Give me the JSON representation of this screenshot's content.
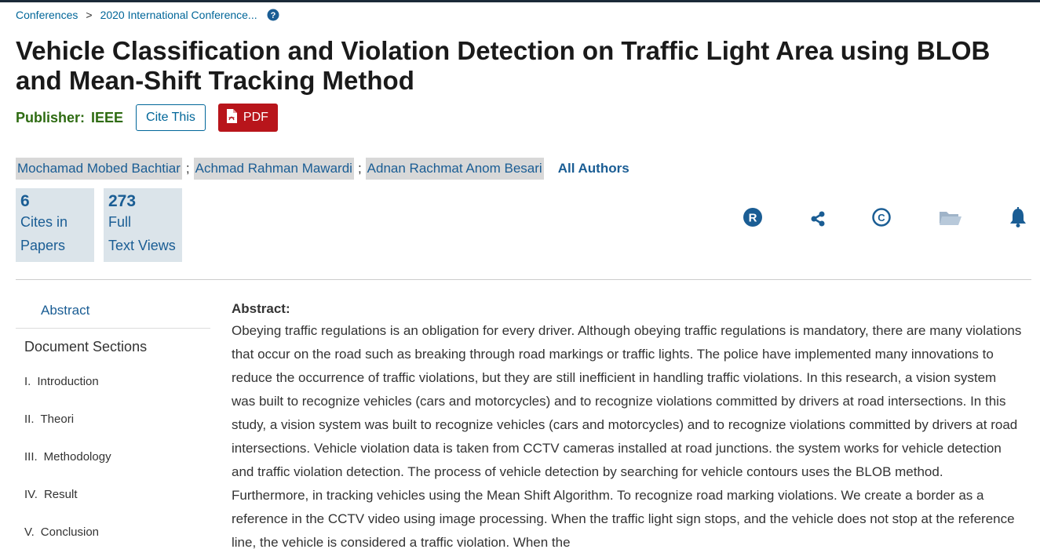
{
  "breadcrumb": {
    "items": [
      "Conferences",
      "2020 International Conference..."
    ],
    "separator": ">",
    "help_icon": "question-circle-icon"
  },
  "title": "Vehicle Classification and Violation Detection on Traffic Light Area using BLOB and Mean-Shift Tracking Method",
  "publisher": {
    "label": "Publisher:",
    "value": "IEEE"
  },
  "buttons": {
    "cite": "Cite This",
    "pdf": "PDF",
    "pdf_icon": "pdf-file-icon"
  },
  "authors": [
    "Mochamad Mobed Bachtiar",
    "Achmad Rahman Mawardi",
    "Adnan Rachmat Anom Besari"
  ],
  "author_separator": ";",
  "all_authors": "All Authors",
  "metrics": [
    {
      "value": "6",
      "line1": "Cites in",
      "line2": "Papers"
    },
    {
      "value": "273",
      "line1": "Full",
      "line2": "Text Views"
    }
  ],
  "actions": [
    "rights-icon",
    "share-icon",
    "copyright-icon",
    "folder-icon",
    "bell-icon"
  ],
  "sidebar": {
    "abstract_link": "Abstract",
    "sections_title": "Document Sections",
    "sections": [
      {
        "num": "I.",
        "label": "Introduction"
      },
      {
        "num": "II.",
        "label": "Theori"
      },
      {
        "num": "III.",
        "label": "Methodology"
      },
      {
        "num": "IV.",
        "label": "Result"
      },
      {
        "num": "V.",
        "label": "Conclusion"
      }
    ]
  },
  "abstract": {
    "heading": "Abstract:",
    "text": "Obeying traffic regulations is an obligation for every driver. Although obeying traffic regulations is mandatory, there are many violations that occur on the road such as breaking through road markings or traffic lights. The police have implemented many innovations to reduce the occurrence of traffic violations, but they are still inefficient in handling traffic violations. In this research, a vision system was built to recognize vehicles (cars and motorcycles) and to recognize violations committed by drivers at road intersections. In this study, a vision system was built to recognize vehicles (cars and motorcycles) and to recognize violations committed by drivers at road intersections. Vehicle violation data is taken from CCTV cameras installed at road junctions. the system works for vehicle detection and traffic violation detection. The process of vehicle detection by searching for vehicle contours uses the BLOB method. Furthermore, in tracking vehicles using the Mean Shift Algorithm. To recognize road marking violations. We create a border as a reference in the CCTV video using image processing. When the traffic light sign stops, and the vehicle does not stop at the reference line, the vehicle is considered a traffic violation. When the"
  },
  "colors": {
    "link": "#006699",
    "author_link": "#1a5d94",
    "publisher": "#2e6b12",
    "pdf_button": "#b8151b",
    "metric_bg": "#dbe4ea",
    "author_bg": "#d8d8d8",
    "icon": "#1a5d94",
    "folder_icon": "#9fb3c8"
  }
}
